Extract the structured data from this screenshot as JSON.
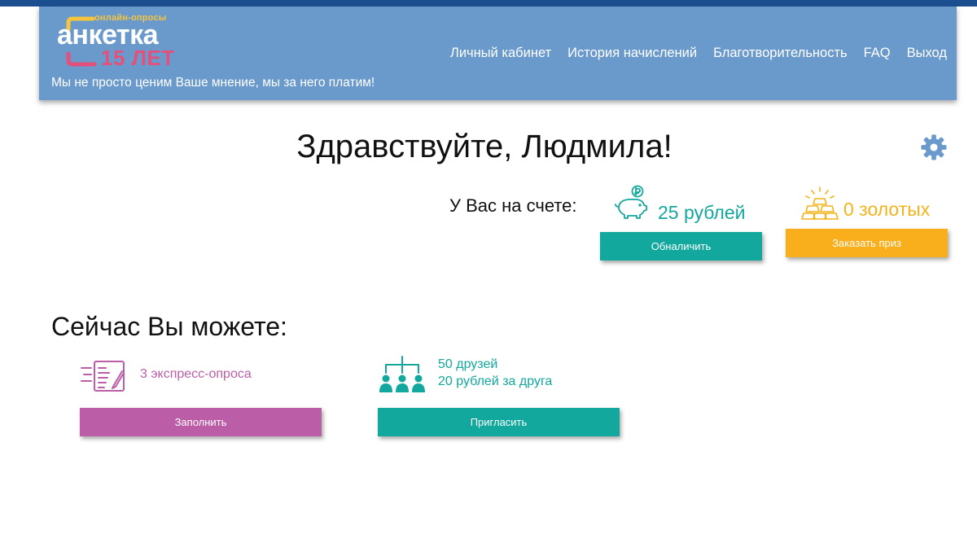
{
  "brand": {
    "logo_tag": "онлайн-опросы",
    "logo_name": "анкетка",
    "logo_years": "15 ЛЕТ",
    "tagline": "Мы не просто ценим Ваше мнение, мы за него платим!",
    "colors": {
      "header": "#6a99cc",
      "stripe": "#1c4f8f",
      "logo_yellow": "#f6c53b",
      "logo_pink": "#e4507b"
    }
  },
  "nav": {
    "items": [
      {
        "label": "Личный кабинет"
      },
      {
        "label": "История начислений"
      },
      {
        "label": "Благотворительность"
      },
      {
        "label": "FAQ"
      },
      {
        "label": "Выход"
      }
    ]
  },
  "greeting": "Здравствуйте, Людмила!",
  "settings_icon": "gear-icon",
  "account": {
    "label": "У Вас на счете:",
    "rubles": "25 рублей",
    "gold": "0 золотых",
    "cashout_label": "Обналичить",
    "prize_label": "Заказать приз",
    "colors": {
      "teal": "#12a89d",
      "orange": "#f9ae1b"
    }
  },
  "now": {
    "title": "Сейчас Вы можете:",
    "survey": {
      "text": "3 экспресс-опроса",
      "button": "Заполнить",
      "color": "#bc5da7",
      "icon": "survey-form-icon"
    },
    "friends": {
      "count": "50 друзей",
      "bonus": "20 рублей за друга",
      "button": "Пригласить",
      "color": "#12a89d",
      "icon": "referral-tree-icon"
    }
  }
}
